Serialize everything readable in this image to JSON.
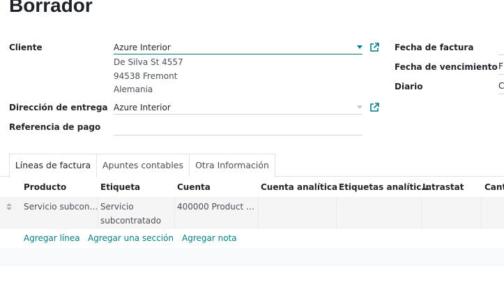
{
  "page": {
    "title": "Borrador"
  },
  "form": {
    "customer_label": "Cliente",
    "customer_value": "Azure Interior",
    "address": [
      "De Silva St 4557",
      "94538 Fremont",
      "Alemania"
    ],
    "delivery_label": "Dirección de entrega",
    "delivery_value": "Azure Interior",
    "payment_ref_label": "Referencia de pago",
    "payment_ref_value": "",
    "invoice_date_label": "Fecha de factura",
    "invoice_date_value": "",
    "due_date_label": "Fecha de vencimiento",
    "due_date_value": "F",
    "journal_label": "Diario",
    "journal_value": "C"
  },
  "tabs": [
    {
      "label": "Líneas de factura",
      "active": true
    },
    {
      "label": "Apuntes contables",
      "active": false
    },
    {
      "label": "Otra Información",
      "active": false
    }
  ],
  "table": {
    "columns": [
      "Producto",
      "Etiqueta",
      "Cuenta",
      "Cuenta analítica",
      "Etiquetas analític…",
      "Intrastat",
      "Cant"
    ],
    "rows": [
      {
        "product": "Servicio subcon…",
        "label_line1": "Servicio",
        "label_line2": "subcontratado",
        "account": "400000 Product …",
        "analytic_account": "",
        "analytic_tags": "",
        "intrastat": ""
      }
    ],
    "actions": [
      "Agregar línea",
      "Agregar una sección",
      "Agregar nota"
    ]
  },
  "icons": {
    "dropdown": "chevron-down-icon",
    "external": "external-link-icon",
    "drag": "drag-handle-icon"
  },
  "colors": {
    "accent": "#017e84",
    "text": "#212529",
    "muted": "#495057"
  }
}
